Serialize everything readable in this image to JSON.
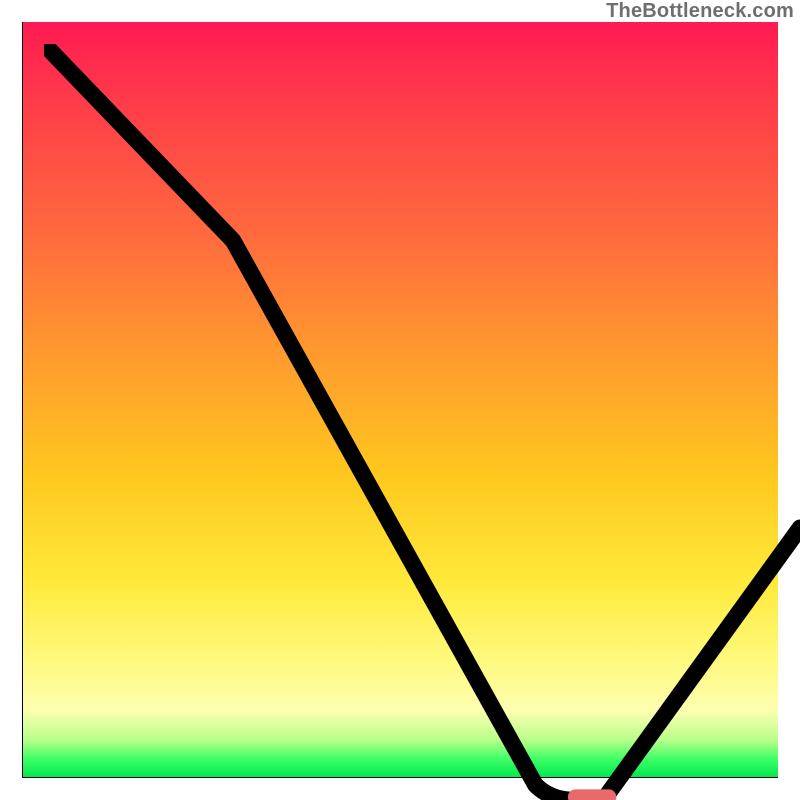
{
  "watermark": "TheBottleneck.com",
  "colors": {
    "gradient_top": "#ff1a52",
    "gradient_mid": "#ffc81e",
    "gradient_bottom_band": "#00e84e",
    "curve": "#000000",
    "marker": "#e86a6a",
    "axis": "#000000"
  },
  "chart_data": {
    "type": "line",
    "title": "",
    "xlabel": "",
    "ylabel": "",
    "xlim": [
      0,
      100
    ],
    "ylim": [
      0,
      100
    ],
    "grid": false,
    "legend": false,
    "series": [
      {
        "name": "bottleneck-curve",
        "x": [
          0,
          25,
          65,
          70,
          74,
          100
        ],
        "y": [
          100,
          74,
          2,
          0,
          0,
          36
        ]
      }
    ],
    "marker": {
      "name": "optimal-point",
      "x_range": [
        70,
        75
      ],
      "y": 0,
      "shape": "capsule",
      "color": "#e86a6a"
    },
    "background": {
      "type": "vertical-gradient",
      "stops": [
        {
          "pos": 0.0,
          "color": "#ff1a52"
        },
        {
          "pos": 0.28,
          "color": "#ff6a3e"
        },
        {
          "pos": 0.6,
          "color": "#ffc81e"
        },
        {
          "pos": 0.84,
          "color": "#fff97a"
        },
        {
          "pos": 0.95,
          "color": "#b8ff8a"
        },
        {
          "pos": 1.0,
          "color": "#00e84e"
        }
      ]
    }
  }
}
